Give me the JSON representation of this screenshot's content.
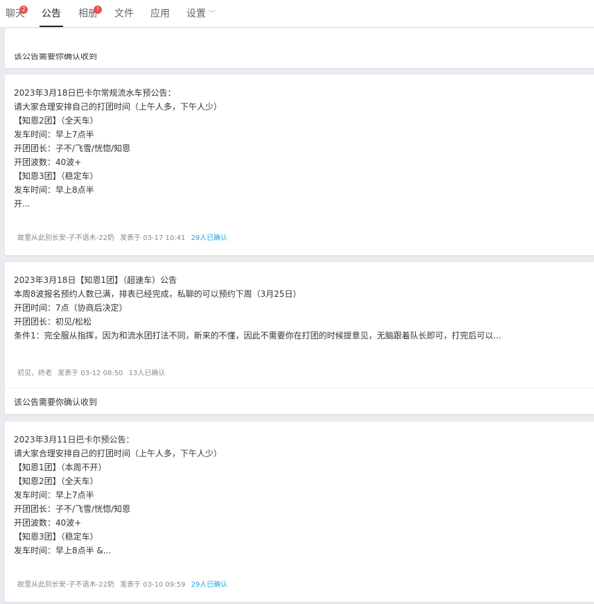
{
  "tabs": [
    {
      "label": "聊天",
      "badge": "2"
    },
    {
      "label": "公告"
    },
    {
      "label": "相册",
      "badge": "!"
    },
    {
      "label": "文件"
    },
    {
      "label": "应用"
    },
    {
      "label": "设置"
    }
  ],
  "top_partial_confirm": "该公告需要你确认收到",
  "notices": [
    {
      "lines": "2023年3月18日巴卡尔常规流水车预公告：\n请大家合理安排自己的打团时间（上午人多，下午人少）\n【知恩2团】（全天车）\n发车时间：早上7点半\n开团团长：子不/飞雪/恍惚/知恩\n开团波数：40波+\n【知恩3团】（稳定车）\n发车时间：早上8点半\n开...",
      "author": "故里从此别长安-子不语木-22奶",
      "posted": "发表于 03-17 10:41",
      "confirmed": "29人已确认"
    },
    {
      "lines": "2023年3月18日【知恩1团】（超速车）公告\n本周8波报名预约人数已满，排表已经完成，私聊的可以预约下周（3月25日）\n开团时间：7点（协商后决定）\n开团团长：初见/松松\n条件1：完全服从指挥，因为和流水团打法不同，新来的不懂，因此不需要你在打团的时候提意见，无脑跟着队长即可，打完后可以...",
      "author": "初见，终老",
      "posted": "发表于 03-12 08:50",
      "confirmed": "13人已确认",
      "confirm_prompt": "该公告需要你确认收到"
    },
    {
      "lines": "2023年3月11日巴卡尔预公告：\n请大家合理安排自己的打团时间（上午人多，下午人少）\n【知恩1团】（本周不开）\n【知恩2团】（全天车）\n发车时间：早上7点半\n开团团长：子不/飞雪/恍惚/知恩\n开团波数：40波+\n【知恩3团】（稳定车）\n发车时间：早上8点半 &...",
      "author": "故里从此别长安-子不语木-22奶",
      "posted": "发表于 03-10 09:59",
      "confirmed": "29人已确认"
    }
  ],
  "colors": {
    "accent": "#1aa6d8",
    "badge": "#e8534a"
  },
  "icons": {
    "settings_dropdown": "chevron-down-icon"
  }
}
